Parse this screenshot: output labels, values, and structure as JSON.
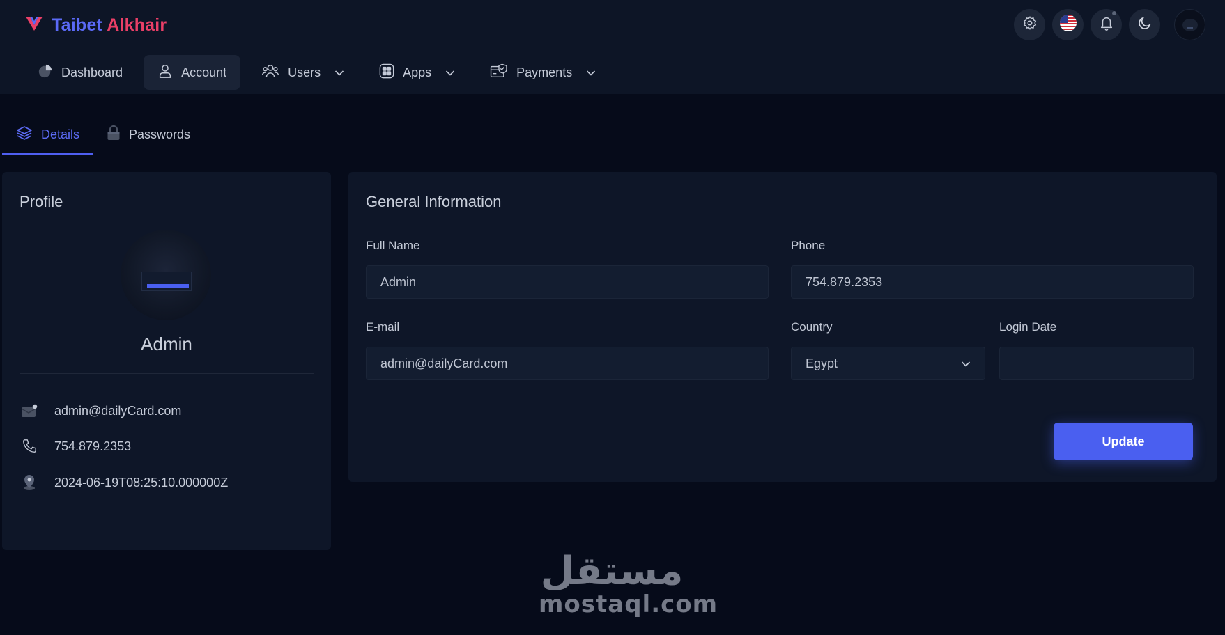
{
  "brand": {
    "part1": "Taibet",
    "part2": "Alkhair",
    "logo_icon": "v-logo-icon"
  },
  "top_actions": {
    "settings_icon": "gear-icon",
    "language_icon": "us-flag-icon",
    "notifications_icon": "bell-icon",
    "theme_icon": "moon-icon",
    "avatar": "user-avatar"
  },
  "nav": {
    "items": [
      {
        "label": "Dashboard",
        "icon": "pie-chart-icon",
        "dropdown": false,
        "active": false
      },
      {
        "label": "Account",
        "icon": "user-icon",
        "dropdown": false,
        "active": true
      },
      {
        "label": "Users",
        "icon": "users-icon",
        "dropdown": true,
        "active": false
      },
      {
        "label": "Apps",
        "icon": "grid-icon",
        "dropdown": true,
        "active": false
      },
      {
        "label": "Payments",
        "icon": "payment-check-icon",
        "dropdown": true,
        "active": false
      }
    ]
  },
  "tabs": [
    {
      "label": "Details",
      "icon": "layers-icon",
      "active": true
    },
    {
      "label": "Passwords",
      "icon": "lock-icon",
      "active": false
    }
  ],
  "profile": {
    "title": "Profile",
    "name": "Admin",
    "email": "admin@dailyCard.com",
    "phone": "754.879.2353",
    "login": "2024-06-19T08:25:10.000000Z"
  },
  "general": {
    "title": "General Information",
    "full_name_label": "Full Name",
    "full_name_value": "Admin",
    "phone_label": "Phone",
    "phone_value": "754.879.2353",
    "email_label": "E-mail",
    "email_value": "admin@dailyCard.com",
    "country_label": "Country",
    "country_value": "Egypt",
    "login_date_label": "Login Date",
    "login_date_value": "",
    "update_label": "Update"
  },
  "watermark": {
    "arabic": "مستقل",
    "latin": "mostaql.com"
  },
  "colors": {
    "accent": "#4a5ff0",
    "brand_blue": "#5b6af7",
    "brand_red": "#ea3f67",
    "background": "#060b1a",
    "card": "#0e1628"
  }
}
